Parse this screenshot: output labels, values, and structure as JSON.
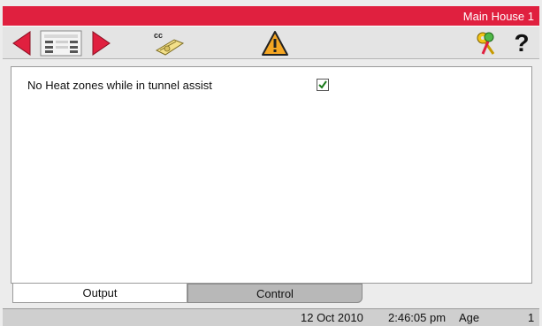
{
  "window": {
    "title": "Main House 1"
  },
  "settings": [
    {
      "label": "No Heat zones while in tunnel assist",
      "checked": true
    }
  ],
  "tabs": [
    {
      "label": "Output",
      "active": true
    },
    {
      "label": "Control",
      "active": false
    }
  ],
  "status": {
    "date": "12 Oct 2010",
    "time": "2:46:05 pm",
    "age_label": "Age",
    "age_value": "1"
  },
  "icons": {
    "back": "left-arrow-icon",
    "list": "list-icon",
    "forward": "right-arrow-icon",
    "cc": "cc-icon",
    "warning": "warning-icon",
    "keys": "keys-icon",
    "help": "help-icon"
  },
  "colors": {
    "titlebar": "#e0203f",
    "arrow": "#e0203f",
    "warning": "#f5a623"
  }
}
